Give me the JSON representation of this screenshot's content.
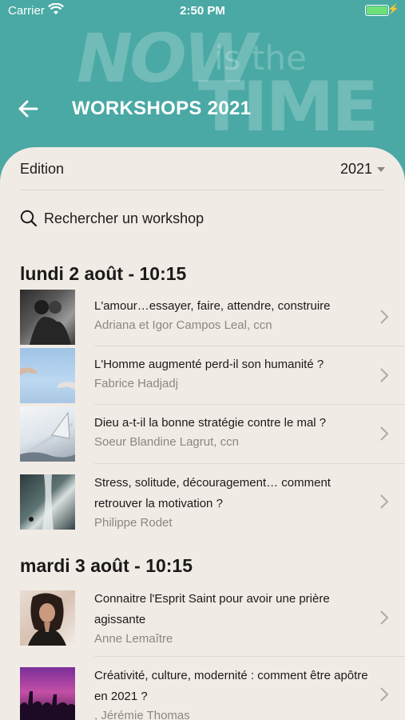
{
  "status": {
    "carrier": "Carrier",
    "time": "2:50 PM"
  },
  "banner": {
    "now": "NOW",
    "is_the": "is the",
    "time": "TIME"
  },
  "header": {
    "title": "WORKSHOPS 2021"
  },
  "edition": {
    "label": "Edition",
    "value": "2021"
  },
  "search": {
    "placeholder": "Rechercher un workshop"
  },
  "sections": [
    {
      "title": "lundi 2 août - 10:15",
      "items": [
        {
          "title": "L'amour…essayer, faire, attendre, construire",
          "author": "Adriana et Igor Campos Leal, ccn"
        },
        {
          "title": "L'Homme augmenté perd-il son humanité ?",
          "author": "Fabrice Hadjadj"
        },
        {
          "title": "Dieu a-t-il la bonne stratégie contre le mal ?",
          "author": "Soeur Blandine Lagrut, ccn"
        },
        {
          "title": "Stress, solitude, découragement… comment retrouver la motivation ?",
          "author": "Philippe Rodet"
        }
      ]
    },
    {
      "title": "mardi 3 août - 10:15",
      "items": [
        {
          "title": "Connaitre l'Esprit Saint pour avoir une prière agissante",
          "author": "Anne Lemaître"
        },
        {
          "title": "Créativité, culture, modernité : comment être apôtre en 2021 ?",
          "author": ", Jérémie Thomas"
        }
      ]
    }
  ]
}
